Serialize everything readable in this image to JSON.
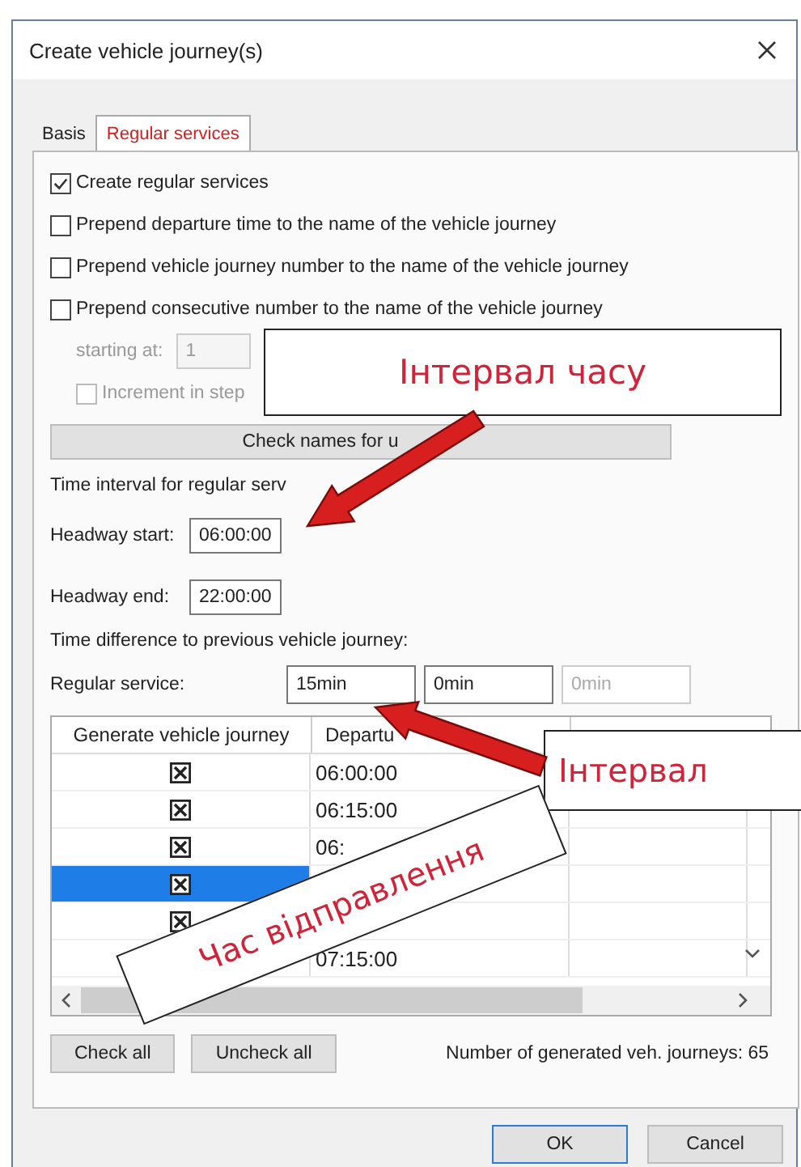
{
  "window": {
    "title": "Create vehicle journey(s)"
  },
  "tabs": [
    {
      "label": "Basis",
      "selected": false
    },
    {
      "label": "Regular services",
      "selected": true
    }
  ],
  "options": [
    {
      "label": "Create regular services",
      "checked": true
    },
    {
      "label": "Prepend departure time to the name of the vehicle journey",
      "checked": false
    },
    {
      "label": "Prepend vehicle journey number to the name of the vehicle journey",
      "checked": false
    },
    {
      "label": "Prepend consecutive number to the name of the vehicle journey",
      "checked": false
    }
  ],
  "starting_at": {
    "label": "starting at:",
    "value": "1",
    "disabled": true
  },
  "increment": {
    "label": "Increment in step",
    "checked": false,
    "disabled": true
  },
  "check_names_button": "Check names for u",
  "time_interval_label": "Time interval for regular serv",
  "headway": [
    {
      "label": "Headway start:",
      "value": "06:00:00"
    },
    {
      "label": "Headway end:",
      "value": "22:00:00"
    }
  ],
  "time_difference_label": "Time difference to previous vehicle journey:",
  "regular_service": {
    "label": "Regular service:",
    "fields": [
      {
        "value": "15min",
        "disabled": false
      },
      {
        "value": "0min",
        "disabled": false
      },
      {
        "value": "0min",
        "disabled": true
      }
    ]
  },
  "table": {
    "columns": [
      "Generate vehicle journey",
      "Departu"
    ],
    "rows": [
      {
        "checked": true,
        "selected": false,
        "departure": "06:00:00"
      },
      {
        "checked": true,
        "selected": false,
        "departure": "06:15:00"
      },
      {
        "checked": true,
        "selected": false,
        "departure": "06:"
      },
      {
        "checked": true,
        "selected": true
      },
      {
        "checked": true,
        "selected": false
      },
      {
        "selected": false,
        "departure": "07:15:00"
      }
    ]
  },
  "check_all_button": "Check all",
  "uncheck_all_button": "Uncheck all",
  "count_text": "Number of generated veh. journeys: 65",
  "ok_button": "OK",
  "cancel_button": "Cancel",
  "annotations": [
    {
      "kind": "callout",
      "text": "Інтервал часу"
    },
    {
      "kind": "arrow"
    },
    {
      "kind": "callout",
      "text": "Інтервал"
    },
    {
      "kind": "arrow"
    },
    {
      "kind": "tilted_callout",
      "text": "Час відправлення"
    }
  ]
}
